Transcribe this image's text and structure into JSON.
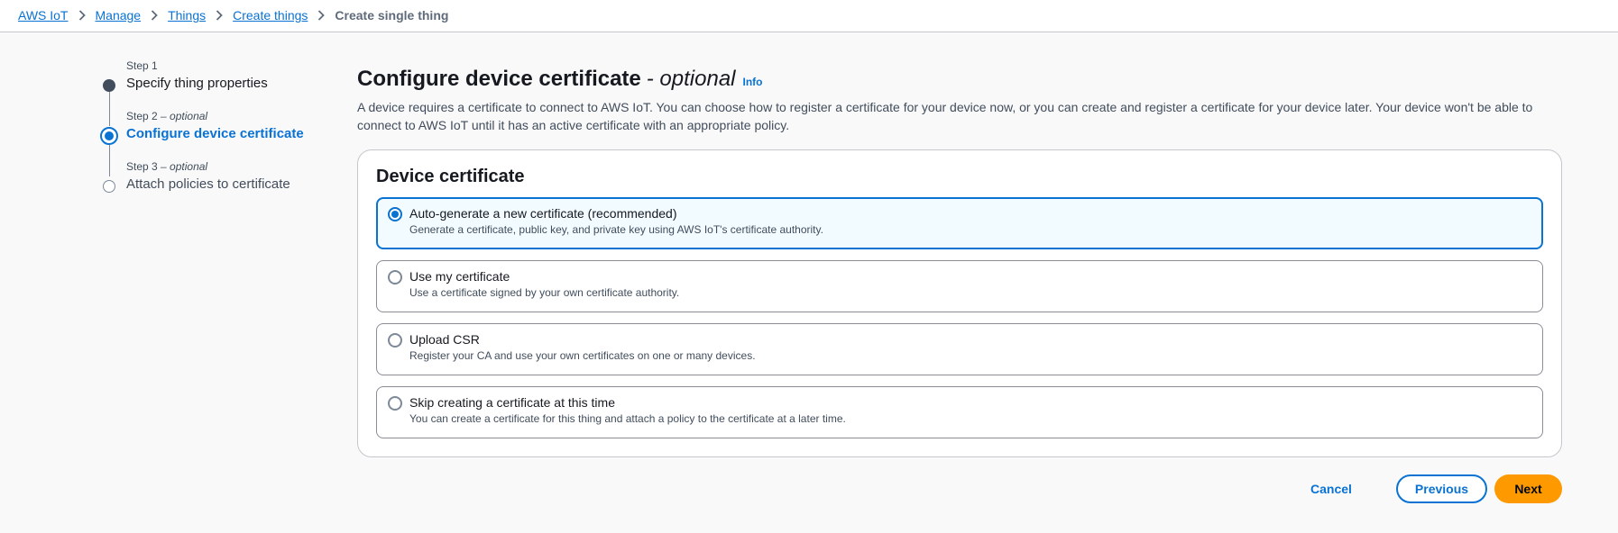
{
  "breadcrumb": {
    "items": [
      "AWS IoT",
      "Manage",
      "Things",
      "Create things"
    ],
    "current": "Create single thing"
  },
  "steps": [
    {
      "label": "Step 1",
      "optional": "",
      "title": "Specify thing properties",
      "state": "complete"
    },
    {
      "label": "Step 2",
      "optional": " – optional",
      "title": "Configure device certificate",
      "state": "active"
    },
    {
      "label": "Step 3",
      "optional": " – optional",
      "title": "Attach policies to certificate",
      "state": "pending"
    }
  ],
  "page": {
    "title": "Configure device certificate",
    "title_optional": "- optional",
    "info": "Info",
    "description": "A device requires a certificate to connect to AWS IoT. You can choose how to register a certificate for your device now, or you can create and register a certificate for your device later. Your device won't be able to connect to AWS IoT until it has an active certificate with an appropriate policy."
  },
  "certificate": {
    "title": "Device certificate",
    "options": [
      {
        "title": "Auto-generate a new certificate (recommended)",
        "description": "Generate a certificate, public key, and private key using AWS IoT's certificate authority.",
        "selected": true
      },
      {
        "title": "Use my certificate",
        "description": "Use a certificate signed by your own certificate authority.",
        "selected": false
      },
      {
        "title": "Upload CSR",
        "description": "Register your CA and use your own certificates on one or many devices.",
        "selected": false
      },
      {
        "title": "Skip creating a certificate at this time",
        "description": "You can create a certificate for this thing and attach a policy to the certificate at a later time.",
        "selected": false
      }
    ]
  },
  "actions": {
    "cancel": "Cancel",
    "previous": "Previous",
    "next": "Next"
  },
  "colors": {
    "accent": "#0972d3",
    "primary_button": "#ff9900",
    "selected_tile_bg": "#f2fbff"
  },
  "icons": {
    "breadcrumb_separator": "chevron-right-icon"
  }
}
